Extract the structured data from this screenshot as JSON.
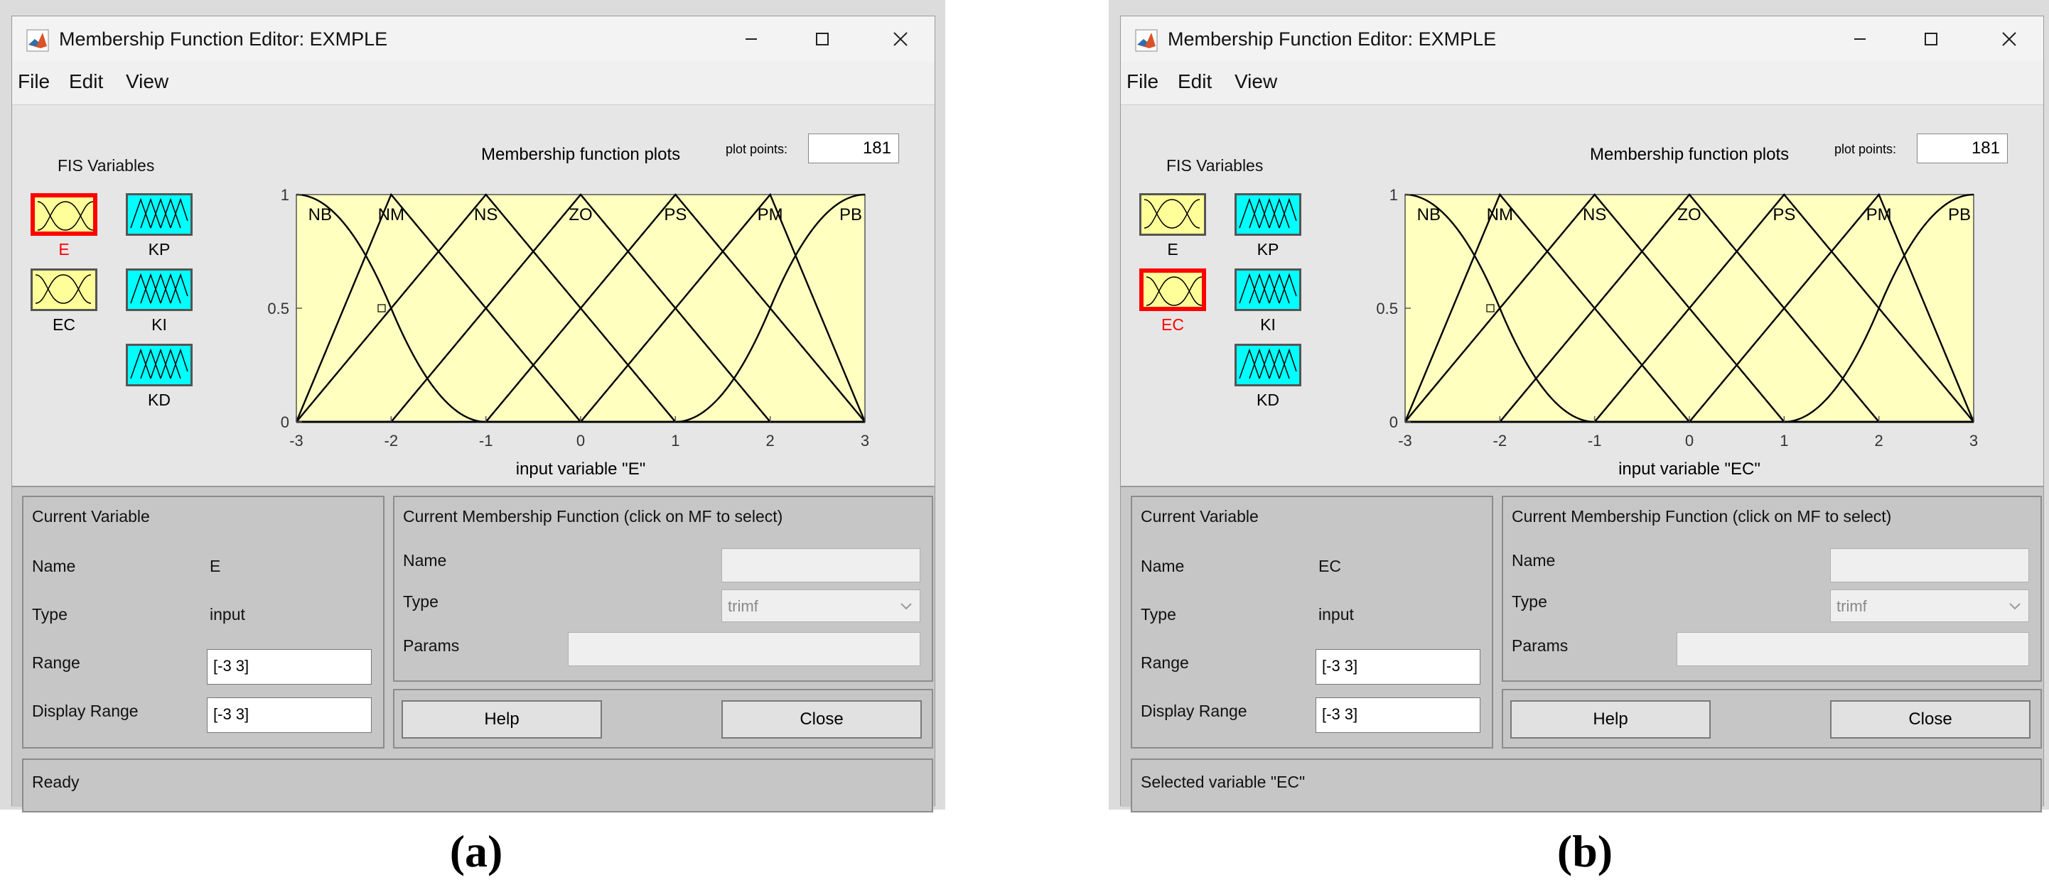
{
  "windows": [
    {
      "title": "Membership Function Editor: EXMPLE",
      "menu": [
        "File",
        "Edit",
        "View"
      ],
      "fis_title": "FIS Variables",
      "variables": [
        {
          "label": "E",
          "type": "input",
          "selected": true
        },
        {
          "label": "EC",
          "type": "input",
          "selected": false
        },
        {
          "label": "KP",
          "type": "output",
          "selected": false
        },
        {
          "label": "KI",
          "type": "output",
          "selected": false
        },
        {
          "label": "KD",
          "type": "output",
          "selected": false
        }
      ],
      "plot_title": "Membership function plots",
      "plot_points_label": "plot points:",
      "plot_points": "181",
      "chart_data": {
        "type": "line",
        "mf_labels": [
          "NB",
          "NM",
          "NS",
          "ZO",
          "PS",
          "PM",
          "PB"
        ],
        "xlim": [
          -3,
          3
        ],
        "ylim": [
          0,
          1
        ],
        "xticks": [
          "-3",
          "-2",
          "-1",
          "0",
          "1",
          "2",
          "3"
        ],
        "yticks": [
          "0",
          "0.5",
          "1"
        ],
        "xlabel": "input variable \"E\"",
        "mfs": [
          {
            "name": "NB",
            "kind": "zmf",
            "params": [
              -3,
              -1
            ]
          },
          {
            "name": "NM",
            "kind": "trimf",
            "params": [
              -3,
              -2,
              0
            ]
          },
          {
            "name": "NS",
            "kind": "trimf",
            "params": [
              -3,
              -1,
              1
            ]
          },
          {
            "name": "ZO",
            "kind": "trimf",
            "params": [
              -2,
              0,
              2
            ]
          },
          {
            "name": "PS",
            "kind": "trimf",
            "params": [
              -1,
              1,
              3
            ]
          },
          {
            "name": "PM",
            "kind": "trimf",
            "params": [
              0,
              2,
              3
            ]
          },
          {
            "name": "PB",
            "kind": "smf",
            "params": [
              1,
              3
            ]
          }
        ]
      },
      "current_variable": {
        "heading": "Current Variable",
        "name_label": "Name",
        "name": "E",
        "type_label": "Type",
        "type": "input",
        "range_label": "Range",
        "range": "[-3 3]",
        "display_range_label": "Display Range",
        "display_range": "[-3 3]"
      },
      "current_mf": {
        "heading": "Current Membership Function (click on MF to select)",
        "name_label": "Name",
        "name": "",
        "type_label": "Type",
        "type": "trimf",
        "params_label": "Params",
        "params": ""
      },
      "help_label": "Help",
      "close_label": "Close",
      "status": "Ready",
      "caption": "(a)"
    },
    {
      "title": "Membership Function Editor: EXMPLE",
      "menu": [
        "File",
        "Edit",
        "View"
      ],
      "fis_title": "FIS Variables",
      "variables": [
        {
          "label": "E",
          "type": "input",
          "selected": false
        },
        {
          "label": "EC",
          "type": "input",
          "selected": true
        },
        {
          "label": "KP",
          "type": "output",
          "selected": false
        },
        {
          "label": "KI",
          "type": "output",
          "selected": false
        },
        {
          "label": "KD",
          "type": "output",
          "selected": false
        }
      ],
      "plot_title": "Membership function plots",
      "plot_points_label": "plot points:",
      "plot_points": "181",
      "chart_data": {
        "type": "line",
        "mf_labels": [
          "NB",
          "NM",
          "NS",
          "ZO",
          "PS",
          "PM",
          "PB"
        ],
        "xlim": [
          -3,
          3
        ],
        "ylim": [
          0,
          1
        ],
        "xticks": [
          "-3",
          "-2",
          "-1",
          "0",
          "1",
          "2",
          "3"
        ],
        "yticks": [
          "0",
          "0.5",
          "1"
        ],
        "xlabel": "input variable \"EC\"",
        "mfs": [
          {
            "name": "NB",
            "kind": "zmf",
            "params": [
              -3,
              -1
            ]
          },
          {
            "name": "NM",
            "kind": "trimf",
            "params": [
              -3,
              -2,
              0
            ]
          },
          {
            "name": "NS",
            "kind": "trimf",
            "params": [
              -3,
              -1,
              1
            ]
          },
          {
            "name": "ZO",
            "kind": "trimf",
            "params": [
              -2,
              0,
              2
            ]
          },
          {
            "name": "PS",
            "kind": "trimf",
            "params": [
              -1,
              1,
              3
            ]
          },
          {
            "name": "PM",
            "kind": "trimf",
            "params": [
              0,
              2,
              3
            ]
          },
          {
            "name": "PB",
            "kind": "smf",
            "params": [
              1,
              3
            ]
          }
        ]
      },
      "current_variable": {
        "heading": "Current Variable",
        "name_label": "Name",
        "name": "EC",
        "type_label": "Type",
        "type": "input",
        "range_label": "Range",
        "range": "[-3 3]",
        "display_range_label": "Display Range",
        "display_range": "[-3 3]"
      },
      "current_mf": {
        "heading": "Current Membership Function (click on MF to select)",
        "name_label": "Name",
        "name": "",
        "type_label": "Type",
        "type": "trimf",
        "params_label": "Params",
        "params": ""
      },
      "help_label": "Help",
      "close_label": "Close",
      "status": "Selected variable \"EC\"",
      "caption": "(b)"
    }
  ],
  "colors": {
    "input_var": "#ffff99",
    "output_var": "#00ffff",
    "selected_border": "#ff0000",
    "plot_bg": "#ffffc0"
  }
}
